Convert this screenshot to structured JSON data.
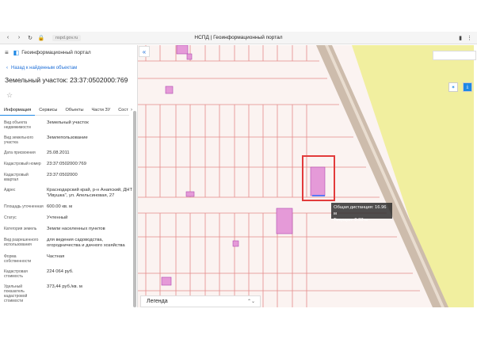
{
  "browser": {
    "url": "nspd.gov.ru",
    "tab_title": "НСПД | Геоинформационный портал",
    "icons": [
      "back-icon",
      "forward-icon",
      "reload-icon",
      "lock-icon",
      "bookmark-icon",
      "menu-icon"
    ]
  },
  "header": {
    "title": "Геоинформационный портал"
  },
  "back_link": "Назад к найденным объектам",
  "object_title": "Земельный участок: 23:37:0502000:769",
  "tabs": [
    "Информация",
    "Сервисы",
    "Объекты",
    "Части ЗУ",
    "Сост"
  ],
  "properties": [
    {
      "k": "Вид объекта недвижимости",
      "v": "Земельный участок"
    },
    {
      "k": "Вид земельного участка",
      "v": "Землепользование"
    },
    {
      "k": "Дата присвоения",
      "v": "25.08.2011"
    },
    {
      "k": "Кадастровый номер",
      "v": "23:37:0502000:769"
    },
    {
      "k": "Кадастровый квартал",
      "v": "23:37:0502000"
    },
    {
      "k": "Адрес",
      "v": "Краснодарский край, р-н Анапский, ДНТ \"Ивушка\", ул. Апельсиновая, 27"
    },
    {
      "k": "Площадь уточненная",
      "v": "600.00 кв. м"
    },
    {
      "k": "Статус",
      "v": "Учтенный"
    },
    {
      "k": "Категория земель",
      "v": "Земли населенных пунктов"
    },
    {
      "k": "Вид разрешенного использования",
      "v": "для ведения садоводства, огородничества и дачного хозяйства"
    },
    {
      "k": "Форма собственности",
      "v": "Частная"
    },
    {
      "k": "Кадастровая стоимость",
      "v": "224 064 руб."
    },
    {
      "k": "Удельный показатель кадастровой стоимости",
      "v": "373,44 руб./кв. м"
    }
  ],
  "map": {
    "measure_total": "Общая дистанция: 16.96 м",
    "measure_current": "Текущая: 0.33 м",
    "legend_label": "Легенда",
    "parcel_stroke": "#e58a8a",
    "highlight_color": "#e23b3b",
    "parcel_fill": "#e59ad8",
    "road_color": "#c9b8a8",
    "green_color": "#f1ef9f"
  }
}
